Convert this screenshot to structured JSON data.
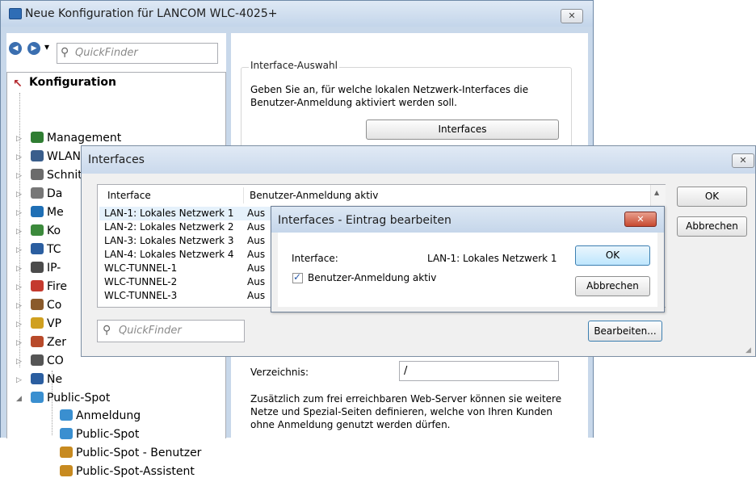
{
  "main_window": {
    "title": "Neue Konfiguration für LANCOM WLC-4025+",
    "close_label": "✕",
    "nav": {
      "back": "◀",
      "forward": "▶",
      "dropdown": "▾",
      "quickfinder_placeholder": "QuickFinder"
    },
    "tree": {
      "root": "Konfiguration",
      "items": [
        {
          "label": "Management"
        },
        {
          "label": "WLAN-Controller"
        },
        {
          "label": "Schnittstellen"
        },
        {
          "label": "Da"
        },
        {
          "label": "Me"
        },
        {
          "label": "Ko"
        },
        {
          "label": "TC"
        },
        {
          "label": "IP-"
        },
        {
          "label": "Fire"
        },
        {
          "label": "Co"
        },
        {
          "label": "VP"
        },
        {
          "label": "Zer"
        },
        {
          "label": "CO"
        },
        {
          "label": "Ne"
        },
        {
          "label": "Public-Spot"
        },
        {
          "label": "Anmeldung"
        },
        {
          "label": "Public-Spot"
        },
        {
          "label": "Public-Spot - Benutzer"
        },
        {
          "label": "Public-Spot-Assistent"
        }
      ]
    },
    "panel": {
      "group_title": "Interface-Auswahl",
      "description": "Geben Sie an, für welche lokalen Netzwerk-Interfaces die Benutzer-Anmeldung aktiviert werden soll.",
      "interfaces_button": "Interfaces",
      "verzeichnis_label": "Verzeichnis:",
      "verzeichnis_value": "/",
      "extra_text": "Zusätzlich zum frei erreichbaren Web-Server können sie weitere Netze und Spezial-Seiten definieren, welche von Ihren Kunden ohne Anmeldung genutzt werden dürfen."
    }
  },
  "interfaces_dialog": {
    "title": "Interfaces",
    "close_label": "✕",
    "columns": [
      "Interface",
      "Benutzer-Anmeldung aktiv"
    ],
    "rows": [
      {
        "interface": "LAN-1: Lokales Netzwerk 1",
        "status": "Aus"
      },
      {
        "interface": "LAN-2: Lokales Netzwerk 2",
        "status": "Aus"
      },
      {
        "interface": "LAN-3: Lokales Netzwerk 3",
        "status": "Aus"
      },
      {
        "interface": "LAN-4: Lokales Netzwerk 4",
        "status": "Aus"
      },
      {
        "interface": "WLC-TUNNEL-1",
        "status": "Aus"
      },
      {
        "interface": "WLC-TUNNEL-2",
        "status": "Aus"
      },
      {
        "interface": "WLC-TUNNEL-3",
        "status": "Aus"
      }
    ],
    "quickfinder_placeholder": "QuickFinder",
    "ok_button": "OK",
    "cancel_button": "Abbrechen",
    "edit_button": "Bearbeiten..."
  },
  "edit_dialog": {
    "title": "Interfaces - Eintrag bearbeiten",
    "close_label": "✕",
    "interface_label": "Interface:",
    "interface_value": "LAN-1: Lokales Netzwerk 1",
    "checkbox_label": "Benutzer-Anmeldung aktiv",
    "checkbox_checked": true,
    "ok_button": "OK",
    "cancel_button": "Abbrechen"
  }
}
